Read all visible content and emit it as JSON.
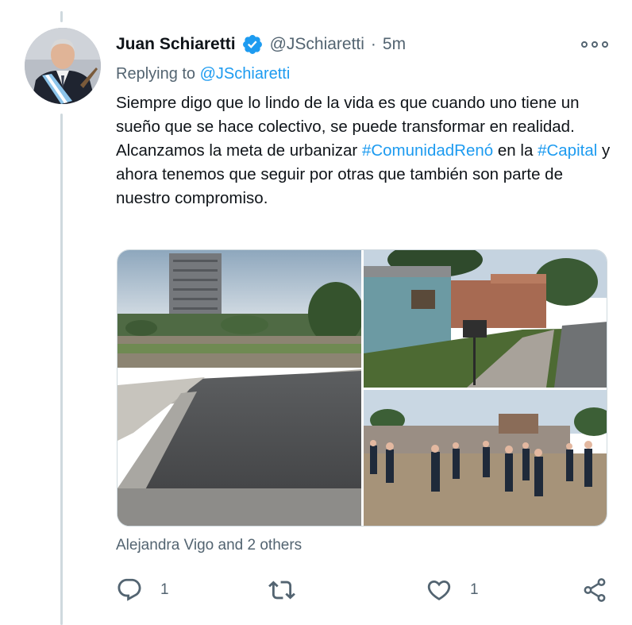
{
  "tweet": {
    "author": {
      "display_name": "Juan Schiaretti",
      "verified": true,
      "handle": "@JSchiaretti"
    },
    "separator": "·",
    "time": "5m",
    "replying": {
      "prefix": "Replying to",
      "mention": "@JSchiaretti"
    },
    "text": {
      "part1": "Siempre digo que lo lindo de la vida es que cuando uno tiene un sueño que se hace colectivo, se puede transformar en realidad. Alcanzamos la meta de urbanizar ",
      "hashtag1": "#ComunidadRenó",
      "part2": " en la ",
      "hashtag2": "#Capital",
      "part3": " y ahora tenemos que seguir por otras que también son parte de nuestro compromiso."
    },
    "likers": "Alejandra Vigo and 2 others",
    "stats": {
      "replies": "1",
      "likes": "1"
    }
  },
  "colors": {
    "accent": "#1d9bf0",
    "secondary_text": "#536471",
    "primary_text": "#0f1419",
    "thread_line": "#cfd9de"
  },
  "icons": [
    "more-options-icon",
    "verified-badge-icon",
    "reply-icon",
    "retweet-icon",
    "like-icon",
    "share-icon"
  ]
}
